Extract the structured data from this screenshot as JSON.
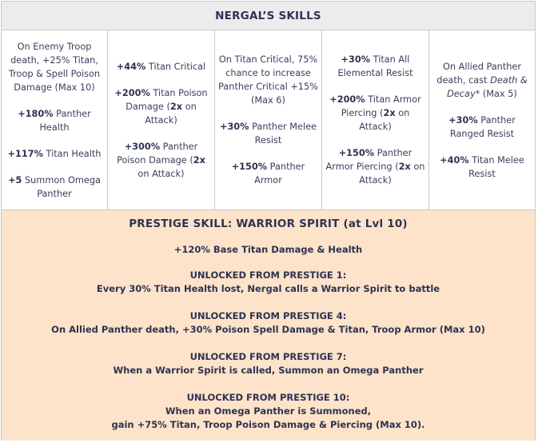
{
  "title": "NERGAL’S SKILLS",
  "columns": [
    {
      "blocks": [
        [
          {
            "t": "On Enemy Troop death, +25% Titan, Troop & Spell Poison Damage (Max 10)",
            "s": "n"
          }
        ],
        [
          {
            "t": "+180%",
            "s": "b"
          },
          {
            "t": " Panther Health",
            "s": "n"
          }
        ],
        [
          {
            "t": "+117%",
            "s": "b"
          },
          {
            "t": " Titan Health",
            "s": "n"
          }
        ],
        [
          {
            "t": "+5",
            "s": "b"
          },
          {
            "t": " Summon Omega Panther",
            "s": "n"
          }
        ]
      ]
    },
    {
      "blocks": [
        [
          {
            "t": "+44%",
            "s": "b"
          },
          {
            "t": " Titan Critical",
            "s": "n"
          }
        ],
        [
          {
            "t": "+200%",
            "s": "b"
          },
          {
            "t": " Titan Poison Damage (",
            "s": "n"
          },
          {
            "t": "2x",
            "s": "b"
          },
          {
            "t": " on Attack)",
            "s": "n"
          }
        ],
        [
          {
            "t": "+300%",
            "s": "b"
          },
          {
            "t": " Panther Poison Damage (",
            "s": "n"
          },
          {
            "t": "2x",
            "s": "b"
          },
          {
            "t": " on Attack)",
            "s": "n"
          }
        ]
      ]
    },
    {
      "blocks": [
        [
          {
            "t": "On Titan Critical, 75% chance to increase Panther Critical +15% (Max 6)",
            "s": "n"
          }
        ],
        [
          {
            "t": "+30%",
            "s": "b"
          },
          {
            "t": " Panther Melee Resist",
            "s": "n"
          }
        ],
        [
          {
            "t": "+150%",
            "s": "b"
          },
          {
            "t": " Panther Armor",
            "s": "n"
          }
        ]
      ]
    },
    {
      "blocks": [
        [
          {
            "t": "+30%",
            "s": "b"
          },
          {
            "t": " Titan All Elemental Resist",
            "s": "n"
          }
        ],
        [
          {
            "t": "+200%",
            "s": "b"
          },
          {
            "t": " Titan Armor Piercing (",
            "s": "n"
          },
          {
            "t": "2x",
            "s": "b"
          },
          {
            "t": " on Attack)",
            "s": "n"
          }
        ],
        [
          {
            "t": "+150%",
            "s": "b"
          },
          {
            "t": " Panther Armor Piercing (",
            "s": "n"
          },
          {
            "t": "2x",
            "s": "b"
          },
          {
            "t": " on Attack)",
            "s": "n"
          }
        ]
      ]
    },
    {
      "blocks": [
        [
          {
            "t": "On Allied Panther death, cast ",
            "s": "n"
          },
          {
            "t": "Death & Decay*",
            "s": "i"
          },
          {
            "t": " (Max 5)",
            "s": "n"
          }
        ],
        [
          {
            "t": "+30%",
            "s": "b"
          },
          {
            "t": " Panther Ranged Resist",
            "s": "n"
          }
        ],
        [
          {
            "t": "+40%",
            "s": "b"
          },
          {
            "t": " Titan Melee Resist",
            "s": "n"
          }
        ]
      ]
    }
  ],
  "prestige": {
    "title": "PRESTIGE SKILL: WARRIOR SPIRIT (at Lvl 10)",
    "base": "+120% Base Titan Damage & Health",
    "unlocks": [
      {
        "heading": "UNLOCKED FROM PRESTIGE 1:",
        "lines": [
          "Every 30% Titan Health lost, Nergal calls a Warrior Spirit to battle"
        ]
      },
      {
        "heading": "UNLOCKED FROM PRESTIGE 4:",
        "lines": [
          "On Allied Panther death, +30% Poison Spell Damage & Titan, Troop Armor (Max 10)"
        ]
      },
      {
        "heading": "UNLOCKED FROM PRESTIGE 7:",
        "lines": [
          "When a Warrior Spirit is called, Summon an Omega Panther"
        ]
      },
      {
        "heading": "UNLOCKED FROM PRESTIGE 10:",
        "lines": [
          "When an Omega Panther is Summoned,",
          "gain +75% Titan, Troop Poison Damage & Piercing (Max 10)."
        ]
      }
    ]
  }
}
